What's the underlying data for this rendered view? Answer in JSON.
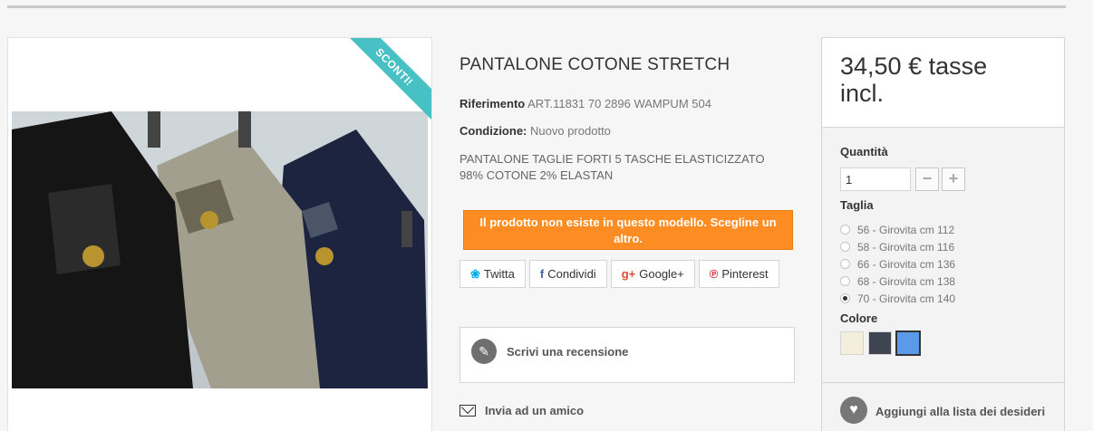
{
  "product": {
    "title": "PANTALONE COTONE STRETCH",
    "sale_badge": "SCONTI!",
    "reference_label": "Riferimento",
    "reference_value": "ART.11831 70 2896 WAMPUM 504",
    "condition_label": "Condizione:",
    "condition_value": "Nuovo prodotto",
    "description_line1": "PANTALONE TAGLIE FORTI 5 TASCHE ELASTICIZZATO",
    "description_line2": "98% COTONE  2% ELASTAN",
    "alert": "Il prodotto non esiste in questo modello. Scegline un altro."
  },
  "share": {
    "buttons": [
      {
        "icon": "twitter-icon",
        "glyph": "🐦",
        "label": "Twitta"
      },
      {
        "icon": "facebook-icon",
        "glyph": "f",
        "label": "Condividi"
      },
      {
        "icon": "google-plus-icon",
        "glyph": "g+",
        "label": "Google+"
      },
      {
        "icon": "pinterest-icon",
        "glyph": "℗",
        "label": "Pinterest"
      }
    ]
  },
  "review": {
    "label": "Scrivi una recensione",
    "icon": "pencil-icon"
  },
  "friend": {
    "label": "Invia ad un amico",
    "icon": "envelope-icon"
  },
  "buy": {
    "price_line1": "34,50 € tasse",
    "price_line2": "incl.",
    "quantity_label": "Quantità",
    "quantity_value": "1",
    "minus": "−",
    "plus": "+",
    "size_label": "Taglia",
    "sizes": [
      {
        "label": "56 - Girovita cm 112",
        "checked": false
      },
      {
        "label": "58 - Girovita cm 116",
        "checked": false
      },
      {
        "label": "66 - Girovita cm 136",
        "checked": false
      },
      {
        "label": "68 - Girovita cm 138",
        "checked": false
      },
      {
        "label": "70 - Girovita cm 140",
        "checked": true
      }
    ],
    "color_label": "Colore",
    "colors": [
      "#f3efdc",
      "#3f4550",
      "#5b9ae8"
    ],
    "selected_color_index": 2,
    "wishlist_label": "Aggiungi alla lista dei desideri"
  },
  "colors": {
    "accent": "#fd8d22",
    "ribbon": "#47c1c4"
  }
}
